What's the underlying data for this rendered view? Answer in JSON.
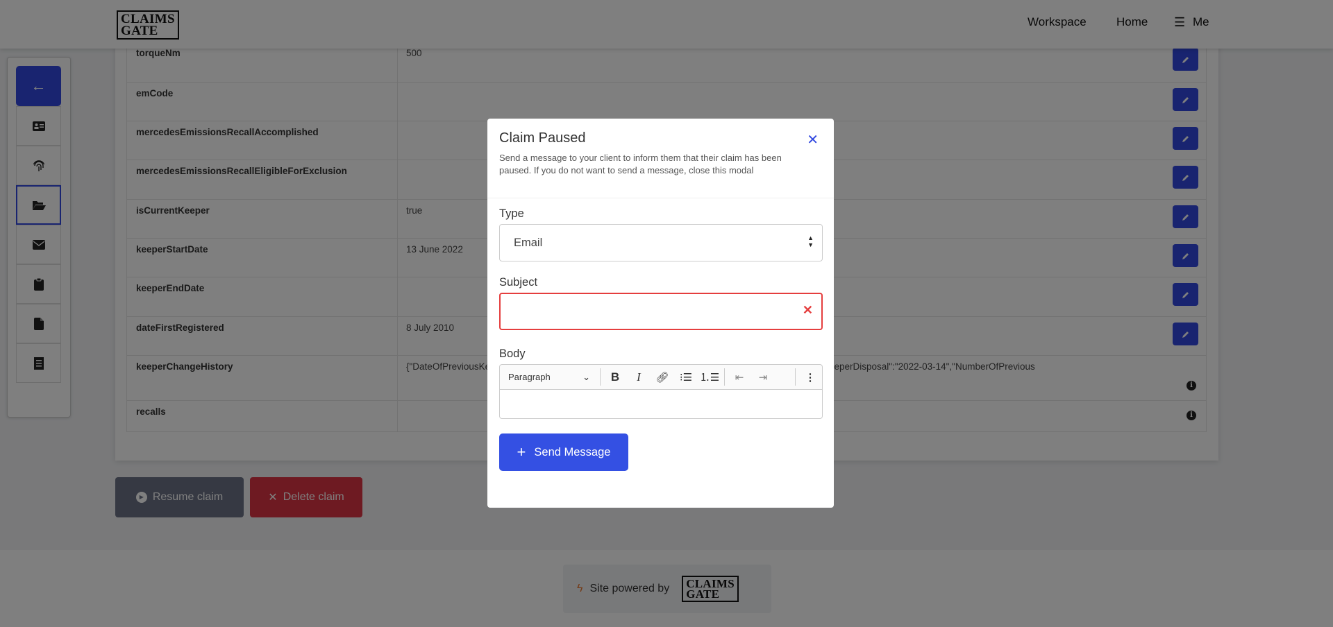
{
  "header": {
    "logo_line1": "CLAIMS",
    "logo_line2": "GATE",
    "nav": [
      {
        "label": "Workspace"
      },
      {
        "label": "Home"
      },
      {
        "label": "Me",
        "icon": "menu-icon"
      }
    ]
  },
  "sidebar": {
    "items": [
      {
        "icon": "arrow-left-icon"
      },
      {
        "icon": "id-card-icon"
      },
      {
        "icon": "fingerprint-icon"
      },
      {
        "icon": "folder-open-icon",
        "active": true
      },
      {
        "icon": "envelope-icon"
      },
      {
        "icon": "clipboard-icon"
      },
      {
        "icon": "file-icon"
      },
      {
        "icon": "receipt-icon"
      }
    ]
  },
  "table": {
    "rows": [
      {
        "key": "torqueNm",
        "value": "500",
        "action": "edit"
      },
      {
        "key": "emCode",
        "value": "",
        "action": "edit"
      },
      {
        "key": "mercedesEmissionsRecallAccomplished",
        "value": "",
        "action": "edit"
      },
      {
        "key": "mercedesEmissionsRecallEligibleForExclusion",
        "value": "",
        "action": "edit"
      },
      {
        "key": "isCurrentKeeper",
        "value": "true",
        "action": "edit"
      },
      {
        "key": "keeperStartDate",
        "value": "13 June 2022",
        "action": "edit"
      },
      {
        "key": "keeperEndDate",
        "value": "",
        "action": "edit"
      },
      {
        "key": "dateFirstRegistered",
        "value": "8 July 2010",
        "action": "edit"
      },
      {
        "key": "keeperChangeHistory",
        "value": "{\"DateOfPreviousKeeperDisposal\":\"...\",\"NumberOfPreviousKeeper\":\"2022-06-14\"}, {\"DateOfPreviousKeeperDisposal\":\"2022-03-14\",\"NumberOfPrevious",
        "action": "info"
      },
      {
        "key": "recalls",
        "value": "",
        "action": "info"
      }
    ]
  },
  "actions": {
    "resume": "Resume claim",
    "delete": "Delete claim"
  },
  "footer": {
    "powered": "Site powered by",
    "logo_line1": "CLAIMS",
    "logo_line2": "GATE"
  },
  "modal": {
    "title": "Claim Paused",
    "description": "Send a message to your client to inform them that their claim has been paused. If you do not want to send a message, close this modal",
    "type_label": "Type",
    "type_value": "Email",
    "subject_label": "Subject",
    "subject_value": "",
    "body_label": "Body",
    "body_format": "Paragraph",
    "send_label": "Send Message"
  },
  "colors": {
    "primary": "#3249e0",
    "danger": "#dc3545",
    "dark": "#6c7286",
    "error_border": "#e53e3e"
  }
}
